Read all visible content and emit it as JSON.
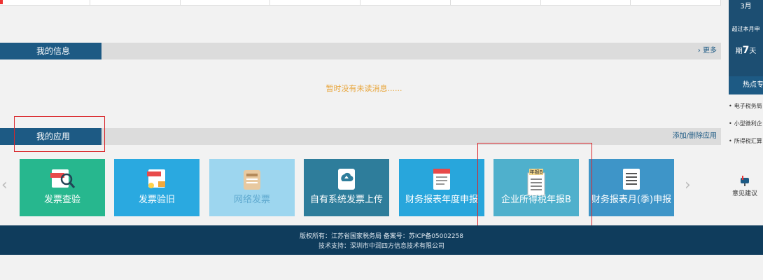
{
  "info_section": {
    "title": "我的信息",
    "more_link": "› 更多",
    "empty_message": "暂时没有未读消息......"
  },
  "app_section": {
    "title": "我的应用",
    "manage_link": "添加/删除应用"
  },
  "apps": [
    {
      "label": "发票查验",
      "icon": "invoice-search-icon",
      "color": "#27b78e"
    },
    {
      "label": "发票验旧",
      "icon": "invoice-verify-icon",
      "color": "#2aa9e0"
    },
    {
      "label": "网络发票",
      "icon": "network-invoice-icon",
      "color": "#9dd6ef"
    },
    {
      "label": "自有系统发票上传",
      "icon": "upload-icon",
      "color": "#2e7d9b"
    },
    {
      "label": "财务报表年度申报",
      "icon": "annual-report-icon",
      "color": "#28a6dc"
    },
    {
      "label": "企业所得税年报B",
      "icon": "income-tax-report-icon",
      "color": "#4fb0cc"
    },
    {
      "label": "财务报表月(季)申报",
      "icon": "monthly-report-icon",
      "color": "#3e95c8"
    }
  ],
  "footer": {
    "copyright": "版权所有：江苏省国家税务局 备案号：苏ICP备05002258",
    "support": "技术支持：深圳市中润四方信息技术有限公司"
  },
  "calendar": {
    "month": "3月",
    "notice": "超过本月申",
    "days_prefix": "期",
    "days_number": "7",
    "days_suffix": "天"
  },
  "hot_topics": {
    "title": "热点专",
    "items": [
      "电子税务局",
      "小型微利企",
      "所得税汇算"
    ]
  },
  "feedback": {
    "label": "意见建议"
  }
}
